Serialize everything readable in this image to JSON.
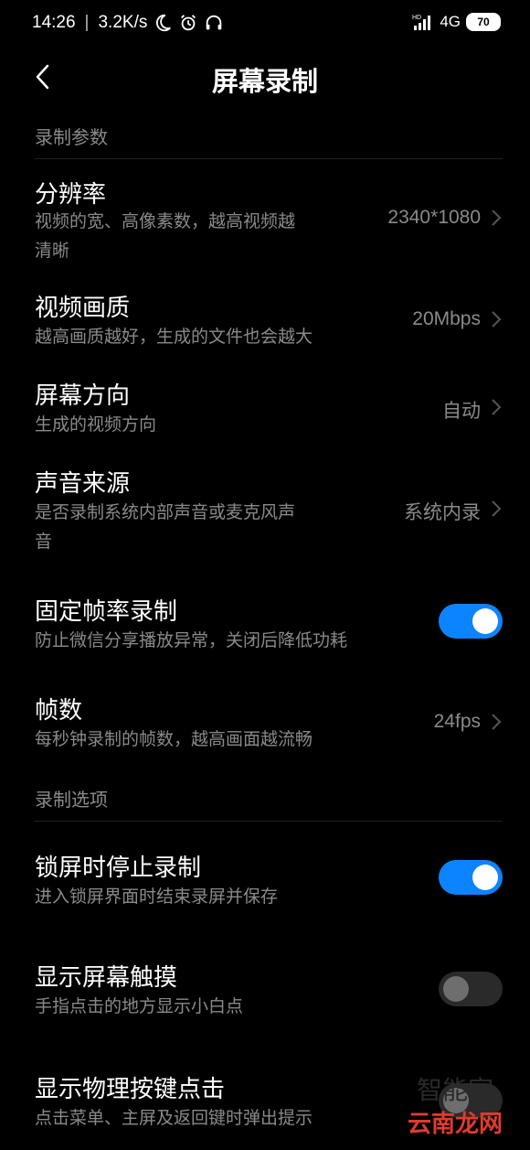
{
  "status_bar": {
    "time": "14:26",
    "speed": "3.2K/s",
    "network": "4G",
    "battery": "70",
    "icons": [
      "moon-icon",
      "alarm-icon",
      "headphones-icon",
      "signal-icon",
      "battery-icon"
    ]
  },
  "header": {
    "title": "屏幕录制",
    "back_icon": "chevron-left-icon"
  },
  "sections": [
    {
      "label": "录制参数"
    },
    {
      "label": "录制选项"
    }
  ],
  "settings": {
    "resolution": {
      "title": "分辨率",
      "sub_line1": "视频的宽、高像素数，越高视频越",
      "sub_line2": "清晰",
      "value": "2340*1080"
    },
    "quality": {
      "title": "视频画质",
      "sub": "越高画质越好，生成的文件也会越大",
      "value": "20Mbps"
    },
    "orientation": {
      "title": "屏幕方向",
      "sub": "生成的视频方向",
      "value": "自动"
    },
    "audio": {
      "title": "声音来源",
      "sub_line1": "是否录制系统内部声音或麦克风声",
      "sub_line2": "音",
      "value": "系统内录"
    },
    "fixed_framerate": {
      "title": "固定帧率录制",
      "sub": "防止微信分享播放异常，关闭后降低功耗",
      "enabled": true
    },
    "fps": {
      "title": "帧数",
      "sub": "每秒钟录制的帧数，越高画面越流畅",
      "value": "24fps"
    },
    "stop_on_lock": {
      "title": "锁屏时停止录制",
      "sub": "进入锁屏界面时结束录屏并保存",
      "enabled": true
    },
    "show_touches": {
      "title": "显示屏幕触摸",
      "sub": "手指点击的地方显示小白点",
      "enabled": false
    },
    "show_keys": {
      "title": "显示物理按键点击",
      "sub": "点击菜单、主屏及返回键时弹出提示",
      "enabled": false
    }
  },
  "watermark": {
    "text": "云南龙网",
    "faint": "智能家"
  },
  "colors": {
    "background": "#000000",
    "toggle_on": "#0d84ff",
    "secondary_text": "#8a8a8a"
  }
}
